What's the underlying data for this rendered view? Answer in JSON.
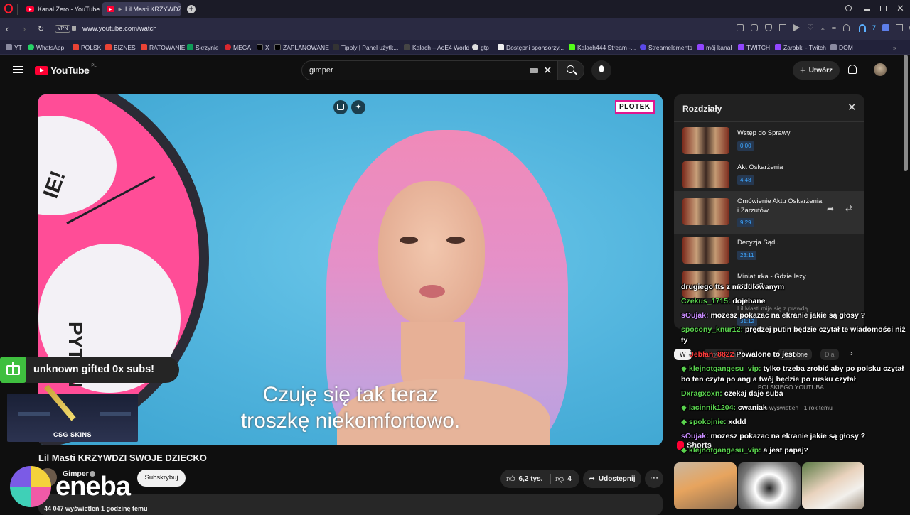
{
  "browser": {
    "tabs": [
      {
        "label": "Kanał Zero - YouTube",
        "active": false
      },
      {
        "label": "Lil Masti KRZYWDZI Sw",
        "active": true
      }
    ],
    "url": "www.youtube.com/watch",
    "vpn_label": "VPN",
    "bookmarks": [
      "YT",
      "WhatsApp",
      "POLSKI",
      "BIZNES",
      "RATOWANIE",
      "Skrzynie",
      "MEGA",
      "X",
      "ZAPLANOWANE",
      "Tipply | Panel użytk...",
      "Kałach – AoE4 World",
      "gtp",
      "Dostępni sponsorzy...",
      "Kalach444 Stream -...",
      "Streamelements",
      "mój kanał",
      "TWITCH",
      "Zarobki - Twitch",
      "DOM"
    ],
    "accent": "#ff0033"
  },
  "youtube": {
    "logo": "YouTube",
    "logo_region": "PL",
    "search_value": "gimper",
    "create_label": "Utwórz",
    "video": {
      "brand_badge": "PLOTEK",
      "wheel_text_top": "IE!",
      "wheel_text_side": "PYTAN",
      "subtitle_line1": "Czuję się tak teraz",
      "subtitle_line2": "troszkę niekomfortowo."
    },
    "title": "Lil Masti KRZYWDZI SWOJE DZIECKO",
    "channel": "Gimper",
    "subscribe_label": "Subskrybuj",
    "likes": "6,2 tys.",
    "dislikes": "4",
    "share_label": "Udostępnij",
    "views_meta": "44 047 wyświetleń  1 godzinę temu",
    "chapters_header": "Rozdziały",
    "chapters": [
      {
        "title": "Wstęp do Sprawy",
        "time": "0:00"
      },
      {
        "title": "Akt Oskarżenia",
        "time": "4:48"
      },
      {
        "title": "Omówienie Aktu Oskarżenia i Zarzutów",
        "time": "9:29"
      },
      {
        "title": "Decyzja Sądu",
        "time": "23:11"
      },
      {
        "title": "Miniaturka - Gdzie leży granica?",
        "time": "31:12"
      },
      {
        "title": "Lil Masti mija się z prawdą",
        "time": ""
      }
    ],
    "filter_chips": [
      "W",
      "Powiązane",
      "Podobne",
      "Dla"
    ],
    "rec_channel": "POLSKIEGO YOUTUBA",
    "rec_meta": "mln wyświetleń · 1 rok temu",
    "shorts_label": "Shorts"
  },
  "stream_overlay": {
    "gift_alert": "unknown gifted 0x subs!",
    "sponsor": "CSG SKINS",
    "eneba": "eneba",
    "chat": [
      {
        "user": "",
        "text": "drugiego tts z modulowanym",
        "color": "#ffffff"
      },
      {
        "user": "Czekus_1715:",
        "text": "dojebane",
        "color": "#5ad34e"
      },
      {
        "user": "sOujak:",
        "text": "mozesz pokazac na ekranie jakie są głosy ?",
        "color": "#c98cff"
      },
      {
        "user": "spocony_knur12:",
        "text": "prędzej putin będzie czytał te wiadomości niż ty",
        "color": "#5ad34e"
      },
      {
        "user": "Jebłan_8822",
        "text": "Powalone to jest",
        "color": "#ff3b3b"
      },
      {
        "user": "klejnotgangesu_vip:",
        "text": "tylko trzeba zrobić aby po polsku czytał bo ten czyta po ang a twój będzie po rusku czytał",
        "color": "#5ad34e"
      },
      {
        "user": "Dxragxoxn:",
        "text": "czekaj daje suba",
        "color": "#5ad34e"
      },
      {
        "user": "lacinnik1204:",
        "text": "cwaniak",
        "color": "#5ad34e"
      },
      {
        "user": "spokojnie:",
        "text": "xddd",
        "color": "#5ad34e"
      },
      {
        "user": "sOujak:",
        "text": "mozesz pokazac na ekranie jakie są głosy ?",
        "color": "#c98cff"
      },
      {
        "user": "klejnotgangesu_vip:",
        "text": "a jest papaj?",
        "color": "#5ad34e"
      }
    ]
  }
}
